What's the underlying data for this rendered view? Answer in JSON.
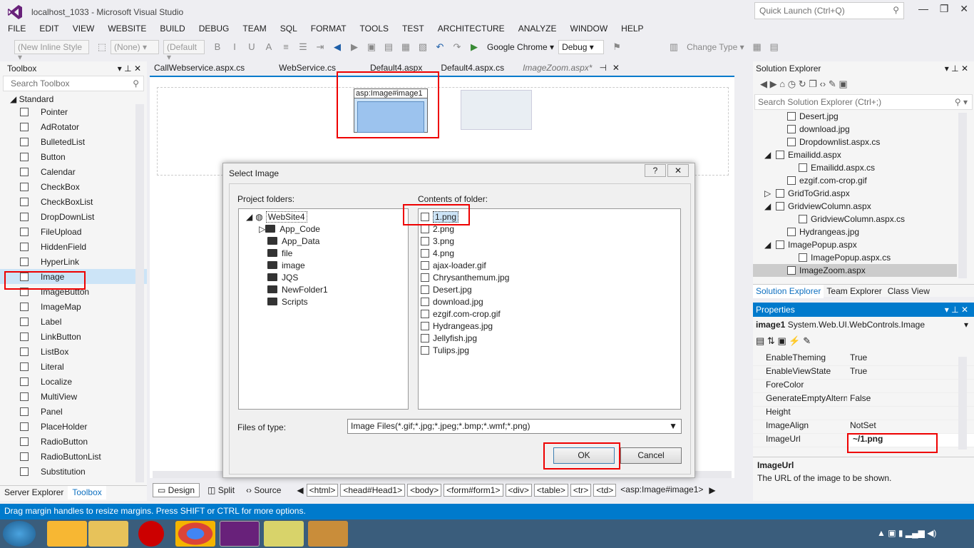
{
  "window": {
    "title": "localhost_1033 - Microsoft Visual Studio",
    "quick_launch": "Quick Launch (Ctrl+Q)"
  },
  "menu": [
    "FILE",
    "EDIT",
    "VIEW",
    "WEBSITE",
    "BUILD",
    "DEBUG",
    "TEAM",
    "SQL",
    "FORMAT",
    "TOOLS",
    "TEST",
    "ARCHITECTURE",
    "ANALYZE",
    "WINDOW",
    "HELP"
  ],
  "toolbar": {
    "style_drop": "(New Inline Style",
    "target_drop": "(None)",
    "font_drop": "(Default",
    "browser": "Google Chrome",
    "config": "Debug",
    "change_type": "Change Type"
  },
  "toolbox": {
    "title": "Toolbox",
    "search": "Search Toolbox",
    "group": "Standard",
    "items": [
      "Pointer",
      "AdRotator",
      "BulletedList",
      "Button",
      "Calendar",
      "CheckBox",
      "CheckBoxList",
      "DropDownList",
      "FileUpload",
      "HiddenField",
      "HyperLink",
      "Image",
      "ImageButton",
      "ImageMap",
      "Label",
      "LinkButton",
      "ListBox",
      "Literal",
      "Localize",
      "MultiView",
      "Panel",
      "PlaceHolder",
      "RadioButton",
      "RadioButtonList",
      "Substitution"
    ],
    "tabs": [
      "Server Explorer",
      "Toolbox"
    ]
  },
  "doc_tabs": [
    "CallWebservice.aspx.cs",
    "WebService.cs",
    "Default4.aspx",
    "Default4.aspx.cs",
    "ImageZoom.aspx*"
  ],
  "designer": {
    "image_tag": "asp:Image#image1"
  },
  "view_tabs": [
    "Design",
    "Split",
    "Source"
  ],
  "breadcrumbs": [
    "<html>",
    "<head#Head1>",
    "<body>",
    "<form#form1>",
    "<div>",
    "<table>",
    "<tr>",
    "<td>",
    "<asp:Image#image1>"
  ],
  "dialog": {
    "title": "Select Image",
    "project_label": "Project folders:",
    "contents_label": "Contents of folder:",
    "root": "WebSite4",
    "folders": [
      "App_Code",
      "App_Data",
      "file",
      "image",
      "JQS",
      "NewFolder1",
      "Scripts"
    ],
    "files": [
      "1.png",
      "2.png",
      "3.png",
      "4.png",
      "ajax-loader.gif",
      "Chrysanthemum.jpg",
      "Desert.jpg",
      "download.jpg",
      "ezgif.com-crop.gif",
      "Hydrangeas.jpg",
      "Jellyfish.jpg",
      "Tulips.jpg"
    ],
    "filetype_label": "Files of type:",
    "filetype_value": "Image Files(*.gif;*.jpg;*.jpeg;*.bmp;*.wmf;*.png)",
    "ok": "OK",
    "cancel": "Cancel",
    "help_btn": "?"
  },
  "solution": {
    "title": "Solution Explorer",
    "search": "Search Solution Explorer (Ctrl+;)",
    "items": [
      "Desert.jpg",
      "download.jpg",
      "Dropdownlist.aspx.cs",
      "Emailidd.aspx",
      "Emailidd.aspx.cs",
      "ezgif.com-crop.gif",
      "GridToGrid.aspx",
      "GridviewColumn.aspx",
      "GridviewColumn.aspx.cs",
      "Hydrangeas.jpg",
      "ImagePopup.aspx",
      "ImagePopup.aspx.cs",
      "ImageZoom.aspx"
    ],
    "tabs": [
      "Solution Explorer",
      "Team Explorer",
      "Class View"
    ]
  },
  "properties": {
    "title": "Properties",
    "object": "image1",
    "object_type": "System.Web.UI.WebControls.Image",
    "rows": [
      {
        "name": "EnableTheming",
        "value": "True"
      },
      {
        "name": "EnableViewState",
        "value": "True"
      },
      {
        "name": "ForeColor",
        "value": ""
      },
      {
        "name": "GenerateEmptyAlternate",
        "value": "False"
      },
      {
        "name": "Height",
        "value": ""
      },
      {
        "name": "ImageAlign",
        "value": "NotSet"
      },
      {
        "name": "ImageUrl",
        "value": "~/1.png"
      }
    ],
    "desc_title": "ImageUrl",
    "desc_text": "The URL of the image to be shown."
  },
  "status": "Drag margin handles to resize margins. Press SHIFT or CTRL for more options.",
  "colors": {
    "accent": "#007acc",
    "highlight": "#e00000",
    "selection": "#cce4f7"
  }
}
